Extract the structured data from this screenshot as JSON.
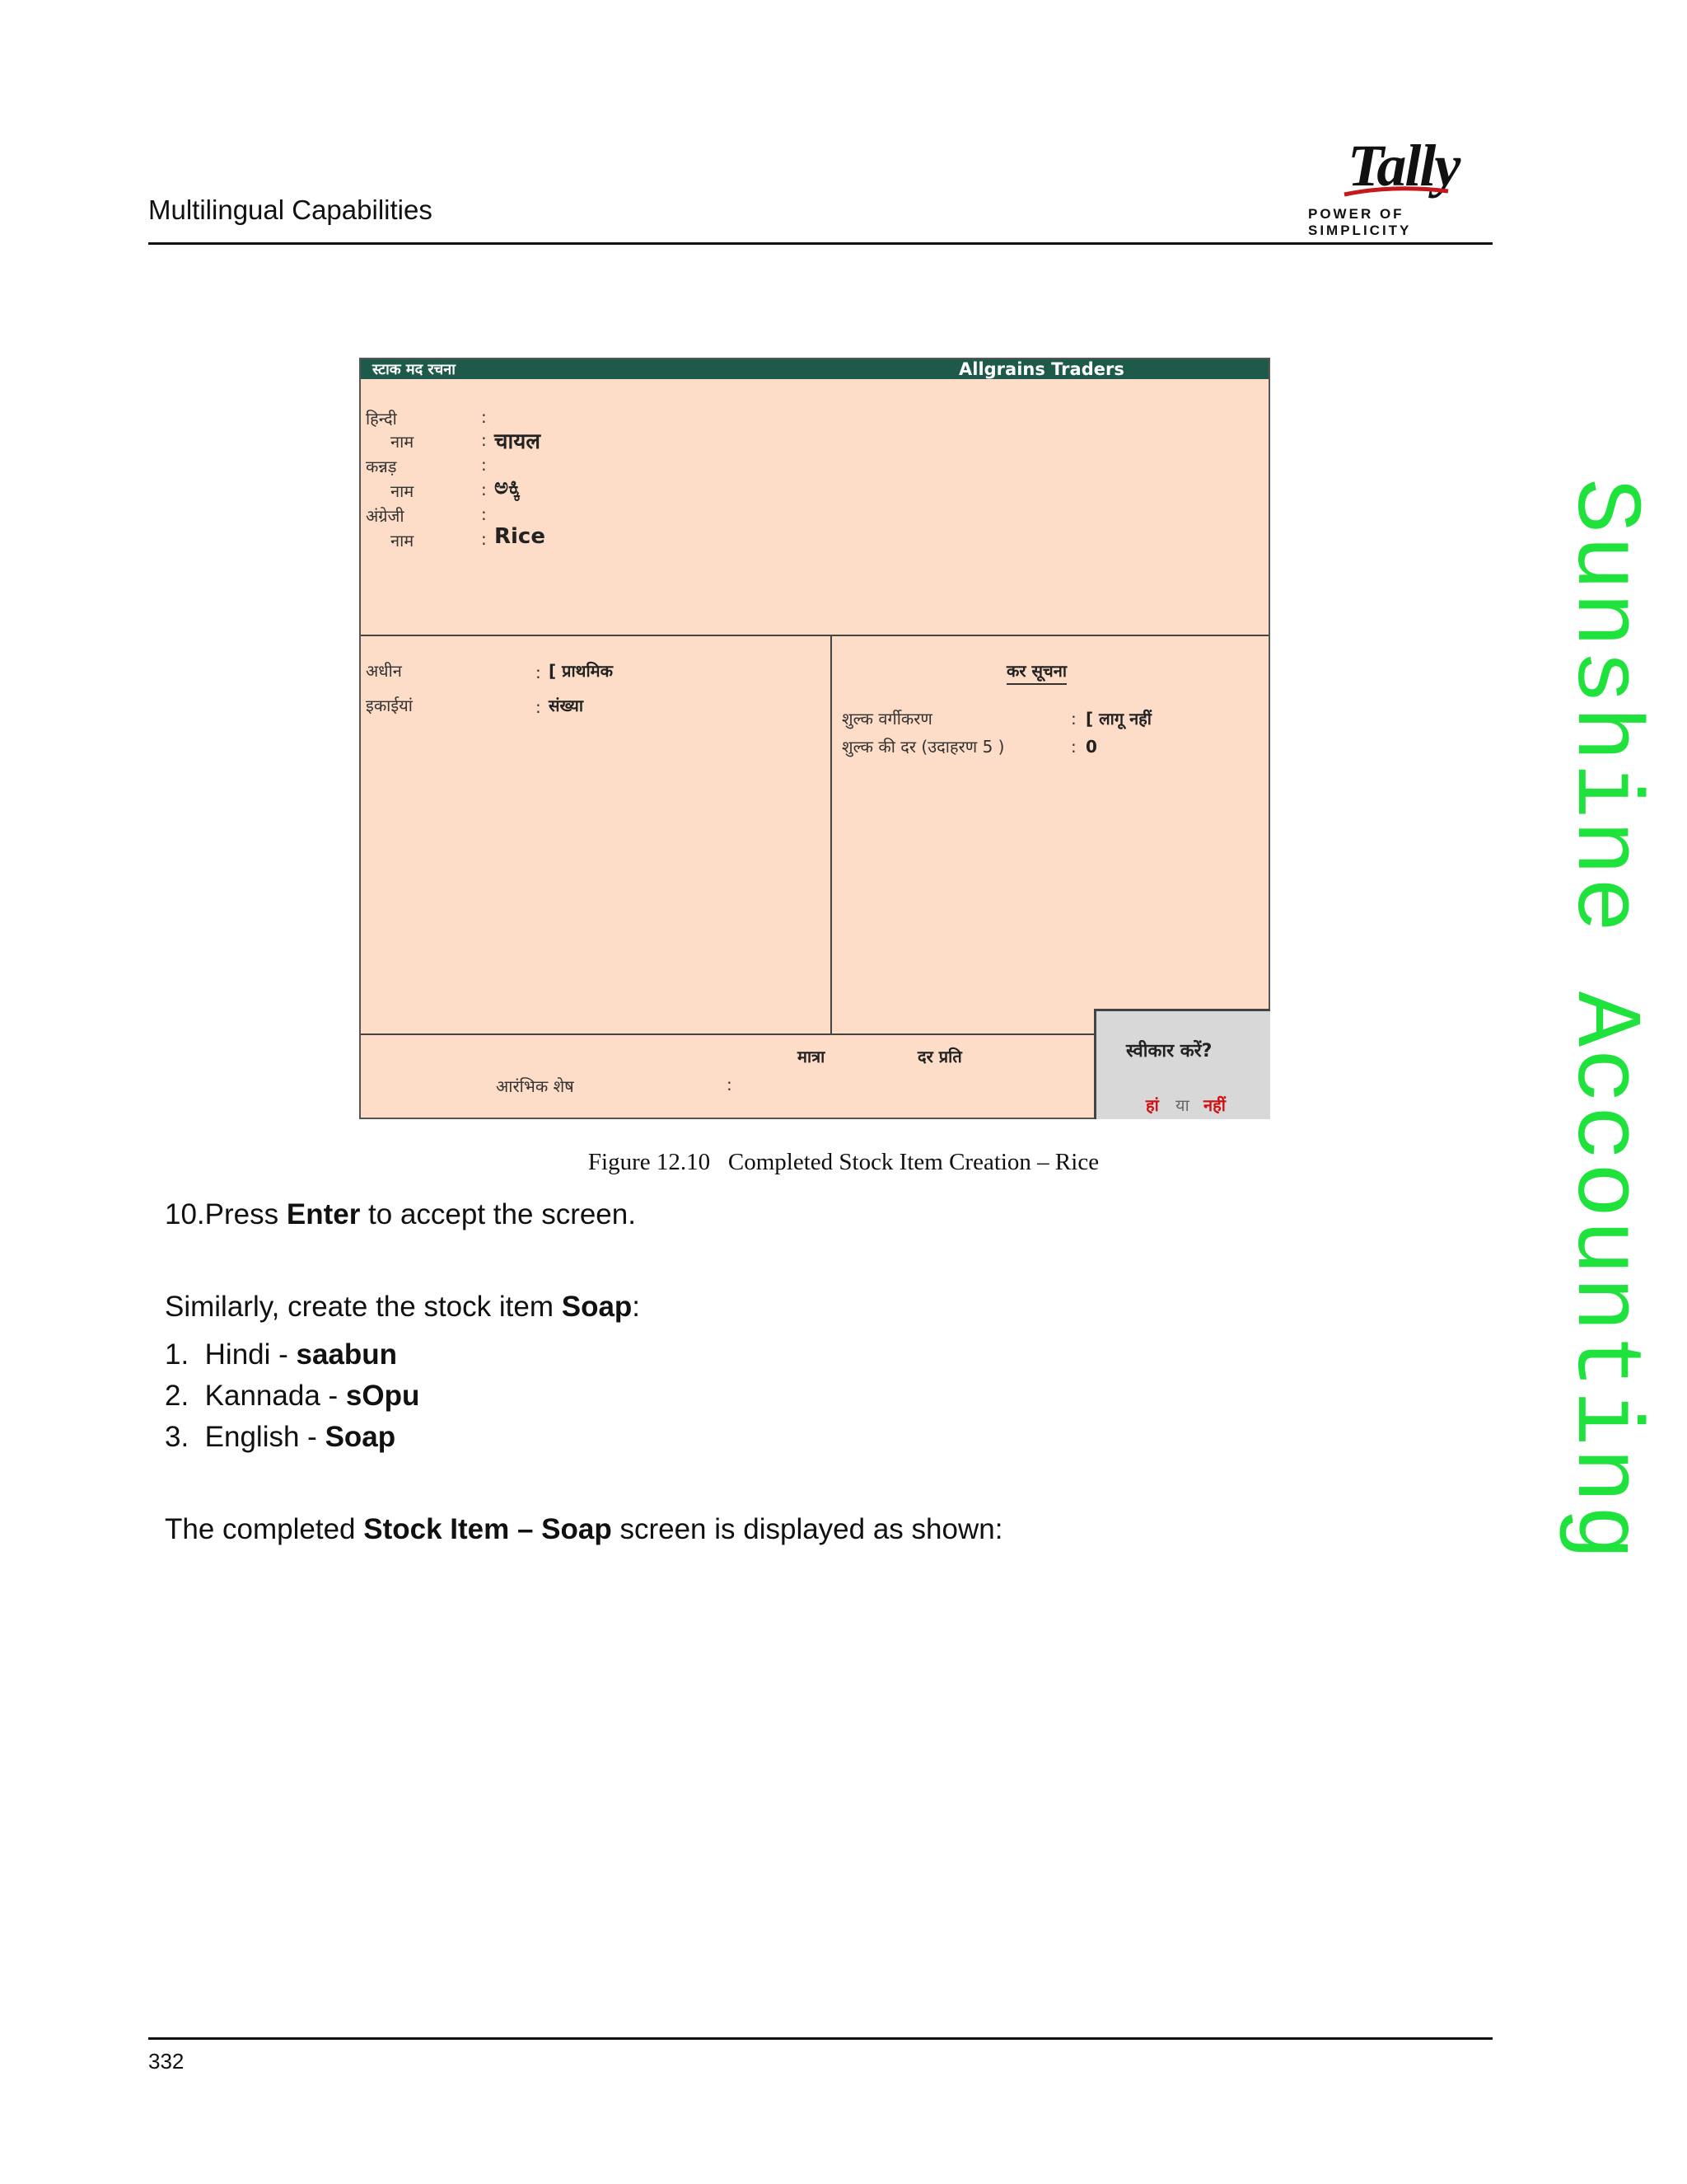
{
  "header": {
    "section_title": "Multilingual Capabilities",
    "logo_word": "Tally",
    "logo_tagline": "POWER OF SIMPLICITY"
  },
  "watermark": "Sunshine Accounting",
  "tally_screen": {
    "title": "स्टाक मद रचना",
    "company": "Allgrains Traders",
    "names": [
      {
        "language": "हिन्दी",
        "name_label": "नाम",
        "value": "चायल"
      },
      {
        "language": "कन्नड़",
        "name_label": "नाम",
        "value": "ಅಕ್ಕಿ"
      },
      {
        "language": "अंग्रेजी",
        "name_label": "नाम",
        "value": "Rice"
      }
    ],
    "under_label": "अधीन",
    "under_value": "[ प्राथमिक",
    "units_label": "इकाईयां",
    "units_value": "संख्या",
    "tax_heading": "कर सूचना",
    "duty_class_label": "शुल्क वर्गीकरण",
    "duty_class_value": "[ लागू नहीं",
    "duty_rate_label": "शुल्क की दर (उदाहरण 5 )",
    "duty_rate_value": "0",
    "qty_header": "मात्रा",
    "rate_header": "दर प्रति",
    "opening_balance_label": "आरंभिक शेष",
    "accept_prompt": "स्वीकार करें?",
    "accept_yes": "हां",
    "accept_or": "या",
    "accept_no": "नहीं"
  },
  "figure_caption": "Figure 12.10   Completed Stock Item Creation – Rice",
  "body": {
    "press_prefix": "10.Press ",
    "press_key": "Enter",
    "press_suffix": " to accept the screen.",
    "similarly_prefix": "Similarly, create the stock item ",
    "similarly_item": "Soap",
    "similarly_suffix": ":",
    "list": [
      {
        "num": "1.",
        "label": "Hindi - ",
        "value": "saabun"
      },
      {
        "num": "2.",
        "label": "Kannada - ",
        "value": "sOpu"
      },
      {
        "num": "3.",
        "label": "English - ",
        "value": "Soap"
      }
    ],
    "completed_prefix": "The completed ",
    "completed_bold": "Stock Item – Soap",
    "completed_suffix": " screen is displayed as shown:"
  },
  "page_number": "332"
}
